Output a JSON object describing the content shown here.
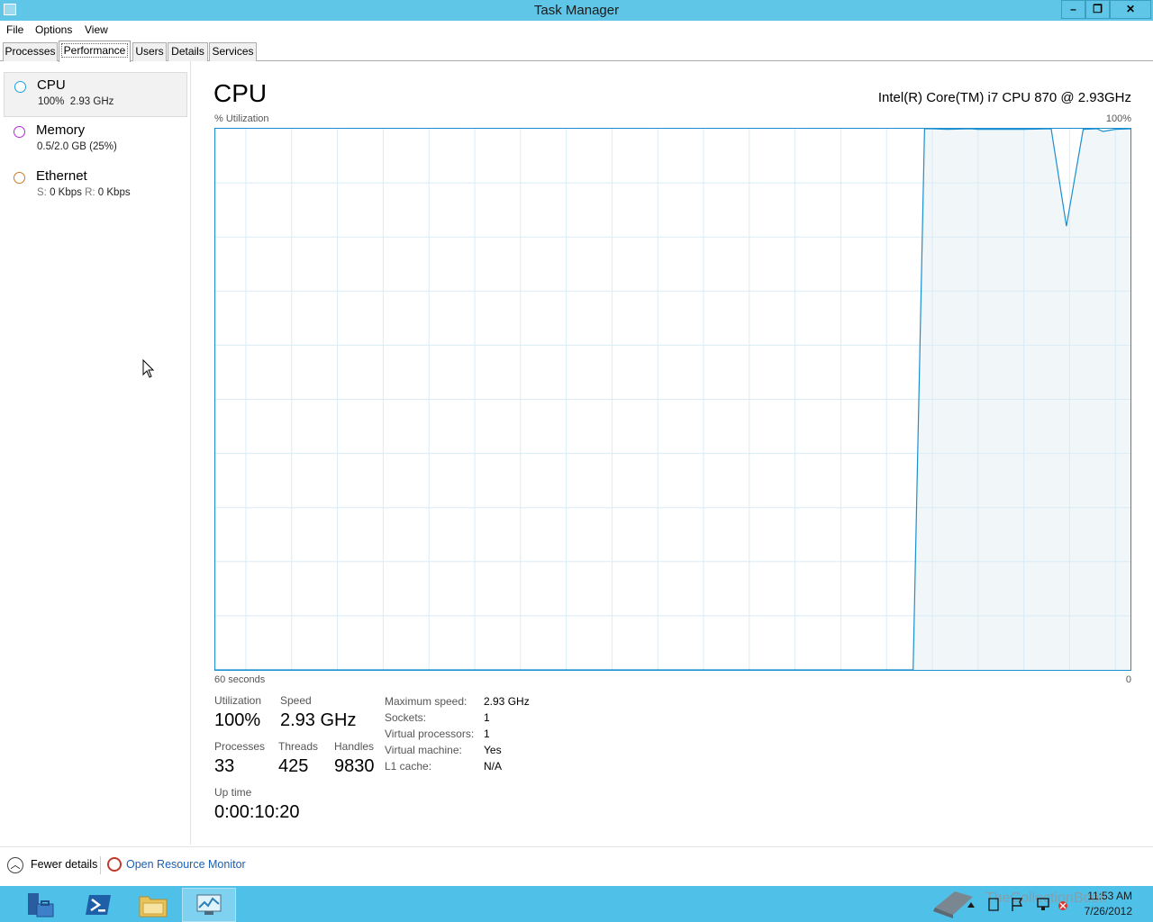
{
  "window": {
    "title": "Task Manager"
  },
  "menu": [
    "File",
    "Options",
    "View"
  ],
  "tabs": [
    "Processes",
    "Performance",
    "Users",
    "Details",
    "Services"
  ],
  "active_tab": "Performance",
  "sidebar": {
    "items": [
      {
        "title": "CPU",
        "sub": "100%  2.93 GHz",
        "color": "#1ba1e2"
      },
      {
        "title": "Memory",
        "sub": "0.5/2.0 GB (25%)",
        "color": "#b22bd4"
      },
      {
        "title": "Ethernet",
        "sub_s_label": "S:",
        "sub_s": "0 Kbps",
        "sub_r_label": "R:",
        "sub_r": "0 Kbps",
        "color": "#c87a2a"
      }
    ]
  },
  "main": {
    "title": "CPU",
    "model": "Intel(R) Core(TM) i7 CPU 870 @ 2.93GHz",
    "chart_top_label": "% Utilization",
    "chart_max_label": "100%",
    "chart_bottom_label": "60 seconds",
    "chart_min_label": "0",
    "stats": {
      "utilization_label": "Utilization",
      "utilization": "100%",
      "speed_label": "Speed",
      "speed": "2.93 GHz",
      "processes_label": "Processes",
      "processes": "33",
      "threads_label": "Threads",
      "threads": "425",
      "handles_label": "Handles",
      "handles": "9830",
      "uptime_label": "Up time",
      "uptime": "0:00:10:20"
    },
    "specs": [
      {
        "k": "Maximum speed:",
        "v": "2.93 GHz"
      },
      {
        "k": "Sockets:",
        "v": "1"
      },
      {
        "k": "Virtual processors:",
        "v": "1"
      },
      {
        "k": "Virtual machine:",
        "v": "Yes"
      },
      {
        "k": "L1 cache:",
        "v": "N/A"
      }
    ]
  },
  "chart_data": {
    "type": "area",
    "x": [
      0,
      45,
      45.75,
      46.5,
      47,
      48,
      49.5,
      50,
      51,
      53,
      54.8,
      55.8,
      56.9,
      57.8,
      58.2,
      59,
      60
    ],
    "values": [
      0,
      0,
      0,
      100,
      100,
      99.9,
      100,
      99.9,
      99.9,
      99.9,
      100,
      82,
      99.9,
      100,
      99.5,
      99.9,
      100
    ],
    "xlim": [
      0,
      60
    ],
    "ylim": [
      0,
      100
    ],
    "grid": true,
    "color": "#1b8fcf",
    "fill": "#f1f6f9",
    "gridcolor": "#d9ecf5"
  },
  "bottom": {
    "fewer_label": "Fewer details",
    "resource_label": "Open Resource Monitor"
  },
  "taskbar": {
    "watermark": "TheCollectionBook",
    "time": "11:53 AM",
    "date": "7/26/2012"
  }
}
